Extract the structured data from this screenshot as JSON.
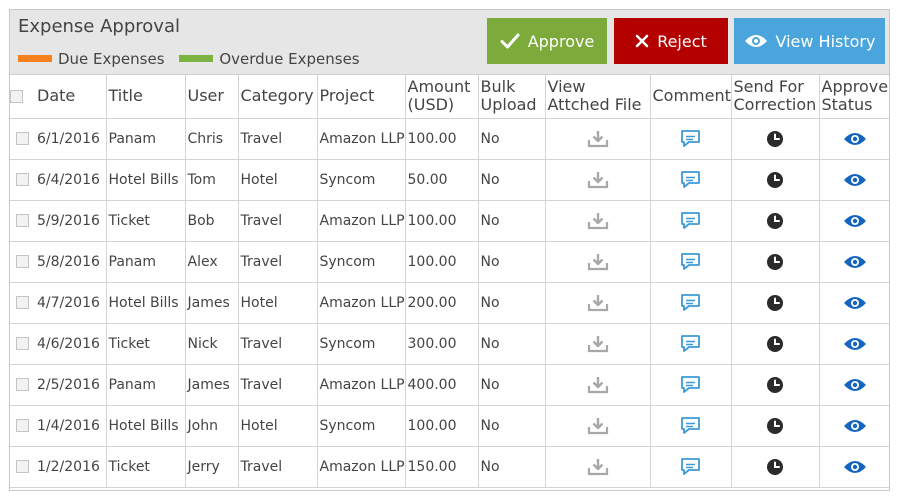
{
  "header": {
    "title": "Expense Approval",
    "legend": [
      {
        "label": "Due Expenses",
        "color": "#f5821f"
      },
      {
        "label": "Overdue Expenses",
        "color": "#7cb342"
      }
    ],
    "buttons": {
      "approve": {
        "label": "Approve",
        "icon": "check-icon",
        "color": "#7cab3c"
      },
      "reject": {
        "label": "Reject",
        "icon": "close-icon",
        "color": "#b50000"
      },
      "view_history": {
        "label": "View History",
        "icon": "eye-icon",
        "color": "#4aa5dc"
      }
    }
  },
  "table": {
    "columns": [
      "Date",
      "Title",
      "User",
      "Category",
      "Project",
      "Amount (USD)",
      "Bulk Upload",
      "View Attched File",
      "Comment",
      "Send For Correction",
      "Approver Status"
    ],
    "rows": [
      {
        "date": "6/1/2016",
        "title": "Panam",
        "user": "Chris",
        "category": "Travel",
        "project": "Amazon LLP",
        "amount": "100.00",
        "bulk": "No"
      },
      {
        "date": "6/4/2016",
        "title": "Hotel Bills",
        "user": "Tom",
        "category": "Hotel",
        "project": "Syncom",
        "amount": "50.00",
        "bulk": "No"
      },
      {
        "date": "5/9/2016",
        "title": "Ticket",
        "user": "Bob",
        "category": "Travel",
        "project": "Amazon LLP",
        "amount": "100.00",
        "bulk": "No"
      },
      {
        "date": "5/8/2016",
        "title": "Panam",
        "user": "Alex",
        "category": "Travel",
        "project": "Syncom",
        "amount": "100.00",
        "bulk": "No"
      },
      {
        "date": "4/7/2016",
        "title": "Hotel Bills",
        "user": "James",
        "category": "Hotel",
        "project": "Amazon LLP",
        "amount": "200.00",
        "bulk": "No"
      },
      {
        "date": "4/6/2016",
        "title": "Ticket",
        "user": "Nick",
        "category": "Travel",
        "project": "Syncom",
        "amount": "300.00",
        "bulk": "No"
      },
      {
        "date": "2/5/2016",
        "title": "Panam",
        "user": "James",
        "category": "Travel",
        "project": "Amazon LLP",
        "amount": "400.00",
        "bulk": "No"
      },
      {
        "date": "1/4/2016",
        "title": "Hotel Bills",
        "user": "John",
        "category": "Hotel",
        "project": "Syncom",
        "amount": "100.00",
        "bulk": "No"
      },
      {
        "date": "1/2/2016",
        "title": "Ticket",
        "user": "Jerry",
        "category": "Travel",
        "project": "Amazon LLP",
        "amount": "150.00",
        "bulk": "No"
      }
    ],
    "row_icons": {
      "attachment": "download-icon",
      "comment": "comment-icon",
      "correction": "send-correction-icon",
      "status": "eye-icon"
    },
    "icon_colors": {
      "download": "#a8a8a8",
      "comment": "#3d9ad6",
      "correction": "#2b2b2b",
      "status": "#1565c0"
    }
  }
}
